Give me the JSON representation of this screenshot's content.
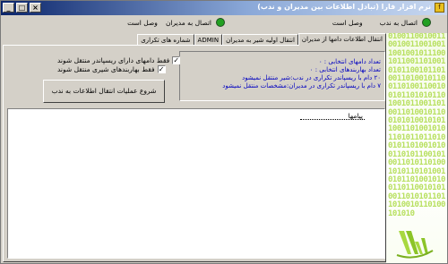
{
  "window": {
    "title": "نرم افزار فارا (تبادل اطلاعات بین مدیران و ندب)",
    "app_icon_glyph": "f",
    "controls": [
      "_",
      "□",
      "×"
    ]
  },
  "status": {
    "ndb": {
      "label": "اتصال به ندب",
      "value": "وصل است"
    },
    "managers": {
      "label": "اتصال به مدیران",
      "value": "وصل است"
    },
    "led_color": "#22a022"
  },
  "tabs": [
    "انتقال اطلاعات دامها از مدیران",
    "انتقال اولیه شیر به مدیران",
    "ADMIN",
    "شماره های تکراری"
  ],
  "info": {
    "lines": [
      "تعداد دامهای انتخابی : ۰",
      "تعداد بهاربندهای انتخابی : ۰",
      "۲۰ دام با ریسپاندر تکراری در ندب:شیر منتقل نمیشود",
      "۷ دام با ریسپاندر تکراری در مدیران:مشخصات منتقل نمیشود"
    ]
  },
  "options": {
    "opt1": "فقط دامهای دارای ریسپاندر منتقل شوند",
    "opt2": "فقط بهاربندهای شیری منتقل شوند",
    "opt1_checked": "✓",
    "opt2_checked": "✓"
  },
  "start_button": "شروع عملیات انتقال اطلاعات به ندب",
  "messages": {
    "header": "پیامها"
  },
  "side": {
    "binary": "010011001001100100110010011001001011100101100110100101011001011010011010010110011010011001001011010101101001011001101001101001011001010100101011001101001010110101101101001011010010100110101100101001101011010010101101010010101101001010011011001010100110101011011010010110100101010"
  }
}
